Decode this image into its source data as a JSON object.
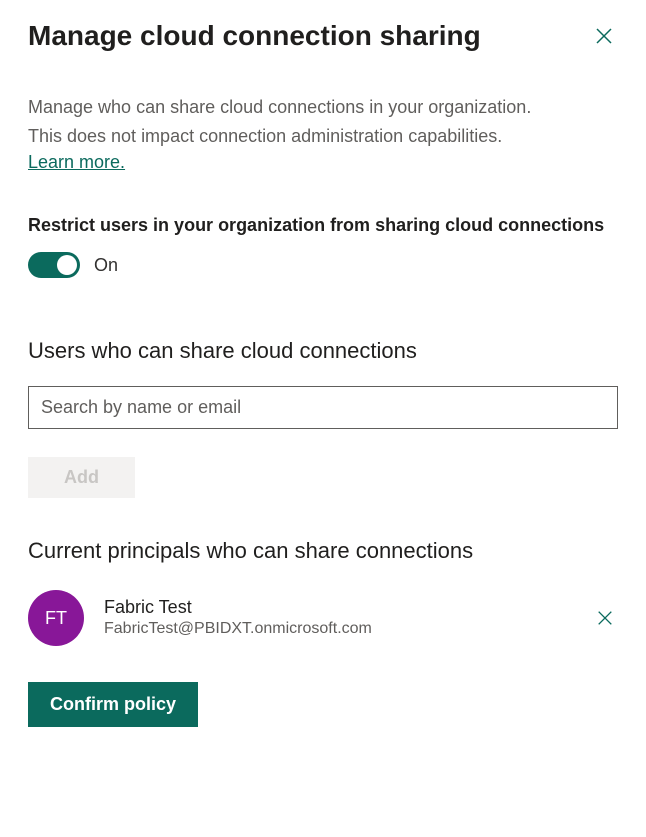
{
  "header": {
    "title": "Manage cloud connection sharing"
  },
  "description": {
    "line1": "Manage who can share cloud connections in your organization.",
    "line2": "This does not impact connection administration capabilities.",
    "learn_more": "Learn more."
  },
  "restrict": {
    "label": "Restrict users in your organization from sharing cloud connections",
    "state": "On"
  },
  "users_section": {
    "heading": "Users who can share cloud connections",
    "search_placeholder": "Search by name or email",
    "add_label": "Add"
  },
  "principals_section": {
    "heading": "Current principals who can share connections",
    "items": [
      {
        "initials": "FT",
        "name": "Fabric Test",
        "email": "FabricTest@PBIDXT.onmicrosoft.com"
      }
    ]
  },
  "footer": {
    "confirm_label": "Confirm policy"
  }
}
